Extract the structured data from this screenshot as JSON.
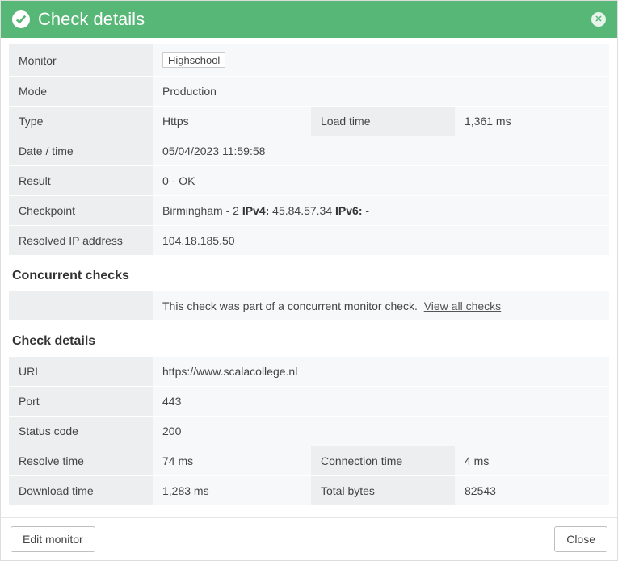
{
  "header": {
    "title": "Check details"
  },
  "summary": {
    "monitor_label": "Monitor",
    "monitor_value": "Highschool",
    "mode_label": "Mode",
    "mode_value": "Production",
    "type_label": "Type",
    "type_value": "Https",
    "loadtime_label": "Load time",
    "loadtime_value": "1,361 ms",
    "datetime_label": "Date / time",
    "datetime_value": "05/04/2023 11:59:58",
    "result_label": "Result",
    "result_value": "0 - OK",
    "checkpoint_label": "Checkpoint",
    "checkpoint_prefix": "Birmingham - 2 ",
    "checkpoint_ipv4_label": "IPv4:",
    "checkpoint_ipv4_value": " 45.84.57.34 ",
    "checkpoint_ipv6_label": "IPv6:",
    "checkpoint_ipv6_value": " -",
    "resolved_label": "Resolved IP address",
    "resolved_value": "104.18.185.50"
  },
  "concurrent": {
    "heading": "Concurrent checks",
    "text": "This check was part of a concurrent monitor check.  ",
    "link": "View all checks"
  },
  "details": {
    "heading": "Check details",
    "url_label": "URL",
    "url_value": "https://www.scalacollege.nl",
    "port_label": "Port",
    "port_value": "443",
    "status_label": "Status code",
    "status_value": "200",
    "resolve_label": "Resolve time",
    "resolve_value": "74 ms",
    "conn_label": "Connection time",
    "conn_value": "4 ms",
    "download_label": "Download time",
    "download_value": "1,283 ms",
    "bytes_label": "Total bytes",
    "bytes_value": "82543"
  },
  "footer": {
    "edit": "Edit monitor",
    "close": "Close"
  }
}
